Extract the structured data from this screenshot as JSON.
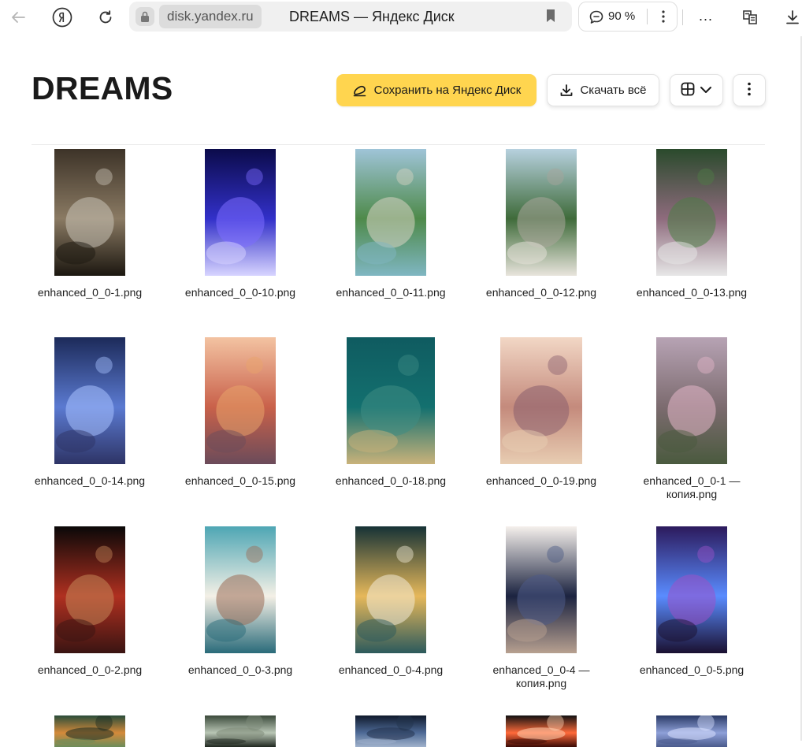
{
  "browser": {
    "address_domain": "disk.yandex.ru",
    "tab_title": "DREAMS — Яндекс Диск",
    "zoom": "90 %",
    "menu_ellipsis": "...",
    "icons": [
      "back-icon",
      "yandex-logo-icon",
      "reload-icon",
      "lock-icon",
      "bookmark-icon",
      "comment-icon",
      "kebab-icon",
      "reader-mode-icon",
      "download-icon"
    ]
  },
  "folder": {
    "title": "DREAMS",
    "save_label": "Сохранить на Яндекс Диск",
    "download_label": "Скачать всё",
    "view_icon": "grid-icon",
    "more_icon": "more-vertical-icon"
  },
  "colors": {
    "accent_button": "#ffd54f",
    "text": "#1a1a1a"
  },
  "files": [
    {
      "name": "enhanced_0_0-1.png"
    },
    {
      "name": "enhanced_0_0-10.png"
    },
    {
      "name": "enhanced_0_0-11.png"
    },
    {
      "name": "enhanced_0_0-12.png"
    },
    {
      "name": "enhanced_0_0-13.png"
    },
    {
      "name": "enhanced_0_0-14.png"
    },
    {
      "name": "enhanced_0_0-15.png"
    },
    {
      "name": "enhanced_0_0-18.png"
    },
    {
      "name": "enhanced_0_0-19.png"
    },
    {
      "name": "enhanced_0_0-1 — копия.png"
    },
    {
      "name": "enhanced_0_0-2.png"
    },
    {
      "name": "enhanced_0_0-3.png"
    },
    {
      "name": "enhanced_0_0-4.png"
    },
    {
      "name": "enhanced_0_0-4 — копия.png"
    },
    {
      "name": "enhanced_0_0-5.png"
    },
    {
      "name": ""
    },
    {
      "name": ""
    },
    {
      "name": ""
    },
    {
      "name": ""
    },
    {
      "name": ""
    }
  ]
}
